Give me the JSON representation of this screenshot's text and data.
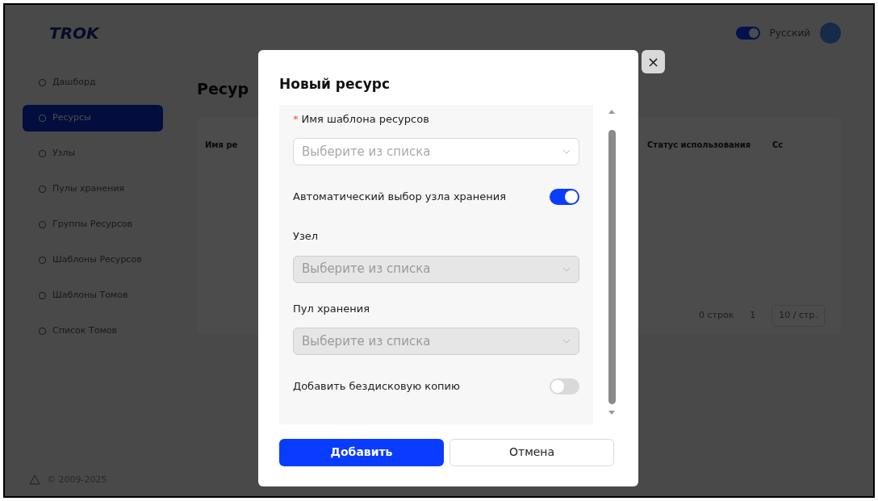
{
  "header": {
    "logo": "TROK",
    "theme_toggle_on": true,
    "language": "Русский"
  },
  "sidebar": {
    "items": [
      {
        "label": "Дашборд",
        "selected": false
      },
      {
        "label": "Ресурсы",
        "selected": true
      },
      {
        "label": "Узлы",
        "selected": false
      },
      {
        "label": "Пулы хранения",
        "selected": false
      },
      {
        "label": "Группы Ресурсов",
        "selected": false
      },
      {
        "label": "Шаблоны Ресурсов",
        "selected": false
      },
      {
        "label": "Шаблоны Томов",
        "selected": false
      },
      {
        "label": "Список Томов",
        "selected": false
      }
    ],
    "footer": "© 2009-2025"
  },
  "page": {
    "title": "Ресур",
    "table": {
      "columns": [
        "Имя ре",
        "Статус использования",
        "Сс"
      ]
    },
    "pagination": {
      "total": "0 строк",
      "page": "1",
      "page_size": "10 / стр."
    }
  },
  "dialog": {
    "title": "Новый ресурс",
    "close": "×",
    "fields": [
      {
        "kind": "select",
        "required_marker": "*",
        "label": "Имя шаблона ресурсов",
        "placeholder": "Выберите из списка",
        "disabled": false
      },
      {
        "kind": "toggle",
        "label": "Автоматический выбор узла хранения",
        "on": true
      },
      {
        "kind": "select",
        "label": "Узел",
        "placeholder": "Выберите из списка",
        "disabled": true
      },
      {
        "kind": "select",
        "label": "Пул хранения",
        "placeholder": "Выберите из списка",
        "disabled": true
      },
      {
        "kind": "toggle",
        "label": "Добавить бездисковую копию",
        "on": false
      }
    ],
    "buttons": [
      {
        "label": "Добавить",
        "primary": true
      },
      {
        "label": "Отмена",
        "primary": false
      }
    ]
  }
}
